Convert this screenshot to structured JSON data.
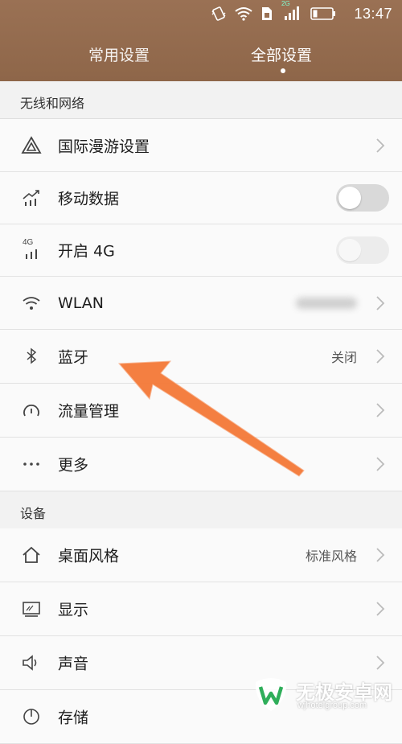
{
  "status_bar": {
    "time": "13:47",
    "network_badge": "2G"
  },
  "tabs": {
    "common": "常用设置",
    "all": "全部设置",
    "active": "全部设置"
  },
  "sections": {
    "wireless": "无线和网络",
    "device": "设备"
  },
  "wireless_items": [
    {
      "label": "国际漫游设置",
      "icon": "roaming-triangle-icon"
    },
    {
      "label": "移动数据",
      "icon": "mobile-data-icon",
      "toggle": "off"
    },
    {
      "label": "开启 4G",
      "icon": "4g-icon",
      "icon_text": "4G",
      "toggle": "off-disabled"
    },
    {
      "label": "WLAN",
      "icon": "wifi-icon"
    },
    {
      "label": "蓝牙",
      "icon": "bluetooth-icon",
      "value": "关闭"
    },
    {
      "label": "流量管理",
      "icon": "data-usage-icon"
    },
    {
      "label": "更多",
      "icon": "more-dots-icon"
    }
  ],
  "device_items": [
    {
      "label": "桌面风格",
      "icon": "home-icon",
      "value": "标准风格"
    },
    {
      "label": "显示",
      "icon": "display-icon"
    },
    {
      "label": "声音",
      "icon": "speaker-icon"
    },
    {
      "label": "存储",
      "icon": "storage-icon"
    }
  ],
  "watermark": {
    "title": "无极安卓网",
    "url": "wjhotelgroup.com"
  },
  "colors": {
    "header": "#8e6649",
    "arrow": "#f47a3a"
  }
}
